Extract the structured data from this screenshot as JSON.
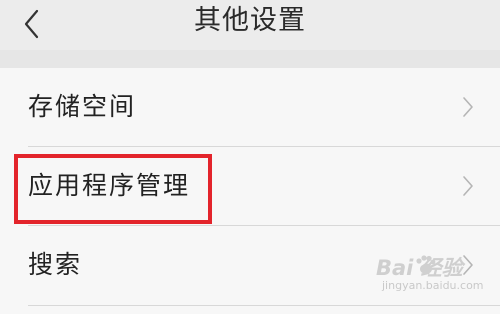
{
  "header": {
    "title": "其他设置",
    "back_icon": "chevron-left-icon"
  },
  "settings": {
    "items": [
      {
        "label": "存储空间",
        "icon": "chevron-right-icon"
      },
      {
        "label": "应用程序管理",
        "icon": "chevron-right-icon",
        "highlighted": true
      },
      {
        "label": "搜索",
        "icon": "chevron-right-icon"
      }
    ]
  },
  "annotation": {
    "highlight_color": "#e3242b"
  },
  "watermark": {
    "brand": "Bai 经验",
    "url": "jingyan.baidu.com"
  }
}
